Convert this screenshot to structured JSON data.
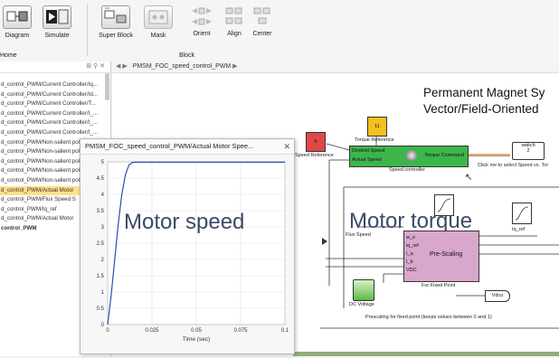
{
  "ribbon": {
    "buttons": [
      {
        "label": "Diagram"
      },
      {
        "label": "Simulate"
      },
      {
        "label": "Super Block"
      },
      {
        "label": "Mask"
      },
      {
        "label": "Orient"
      },
      {
        "label": "Align"
      },
      {
        "label": "Center"
      }
    ],
    "group_home": "Home",
    "group_block": "Block"
  },
  "breadcrumb": {
    "path": "PMSM_FOC_speed_control_PWM"
  },
  "browser": {
    "items": [
      "d_control_PWM/Current Controller/Iq...",
      "d_control_PWM/Current Controller/Id...",
      "d_control_PWM/Current Controller/T...",
      "d_control_PWM/Current Controller/I_...",
      "d_control_PWM/Current Controller/I_...",
      "d_control_PWM/Current Controller/I_...",
      "d_control_PWM/Non-salient pole...",
      "d_control_PWM/Non-salient pole...",
      "d_control_PWM/Non-salient pole...",
      "d_control_PWM/Non-salient pole...",
      "d_control_PWM/Non-salient pole...",
      "d_control_PWM/Actual Motor",
      "d_control_PWM/Flux Speed S",
      "d_control_PWM/Iq_ref",
      "d_control_PWM/Actual Motor",
      "control_PWM"
    ],
    "selected_index": 11
  },
  "diagram": {
    "title_line1": "Permanent Magnet Sy",
    "title_line2": "Vector/Field-Oriented",
    "speed_ref_value": "6",
    "speed_ref_label": "Speed Reference",
    "torque_ref_value": "11",
    "torque_ref_label": "Torque Reference",
    "controller_in1": "Desired Speed",
    "controller_in2": "Actual Speed",
    "controller_out": "Torque Command",
    "controller_label": "Speed controller",
    "switch_label": "switch",
    "switch_value": "2",
    "switch_hint": "Click me to select Speed vs. Tor",
    "motor_torque_label": "Motor torque",
    "flux_speed_label": "Flux Speed",
    "iq_ref_label": "Iq_ref",
    "prescale_label": "Pre-Scaling",
    "prescale_ports": [
      "w_e",
      "iq_ref",
      "I_a",
      "I_b",
      "VDC"
    ],
    "fixed_point_label": "For Fixed Point",
    "dc_voltage_label": "DC Voltage",
    "vdco_label": "Vdco",
    "prescale_note": "Prescaling for fixed point (keeps values between 0 and 1)"
  },
  "plot": {
    "window_title": "PMSM_FOC_speed_control_PWM/Actual Motor Spee...",
    "overlay_label": "Motor speed"
  },
  "chart_data": {
    "type": "line",
    "title": "",
    "xlabel": "Time (sec)",
    "ylabel": "",
    "xlim": [
      0,
      0.1
    ],
    "ylim": [
      0,
      5
    ],
    "xticks": [
      "0",
      "0.025",
      "0.05",
      "0.075",
      "0.1"
    ],
    "yticks": [
      "0",
      "0.5",
      "1",
      "1.5",
      "2",
      "2.5",
      "3",
      "3.5",
      "4",
      "4.5",
      "5"
    ],
    "grid": true,
    "series": [
      {
        "color": "#2a4fb0",
        "x": [
          0,
          0.002,
          0.004,
          0.006,
          0.008,
          0.01,
          0.012,
          0.014,
          0.016,
          0.02,
          0.03,
          0.05,
          0.075,
          0.1
        ],
        "y": [
          0,
          0.9,
          2.0,
          3.1,
          4.0,
          4.6,
          4.9,
          4.98,
          4.99,
          4.99,
          4.99,
          4.99,
          4.99,
          4.99
        ]
      }
    ]
  },
  "colors": {
    "accent_yellow": "#ffe08a",
    "speed_ref": "#e04848",
    "torque_ref": "#f2c21d",
    "controller": "#3cb64a",
    "prescale": "#d9a6cc",
    "signal_orange": "#e8912a"
  }
}
